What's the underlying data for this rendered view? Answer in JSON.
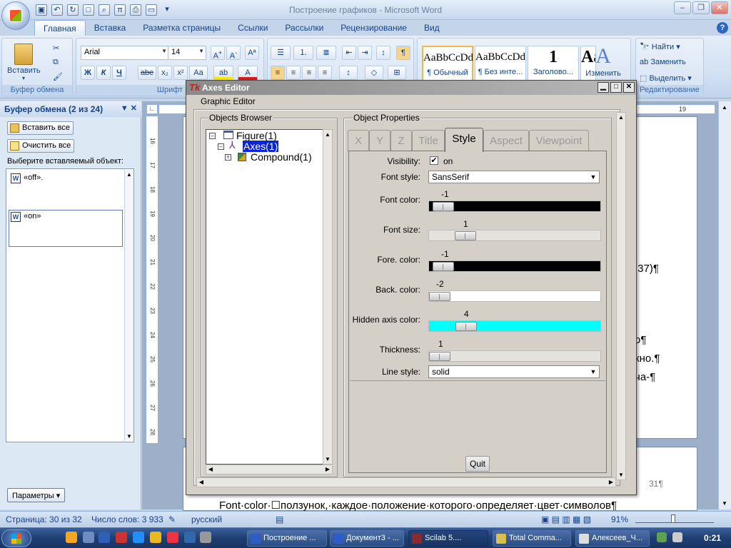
{
  "app": {
    "title": "Построение графиков - Microsoft Word",
    "help": "?"
  },
  "tabs": [
    "Главная",
    "Вставка",
    "Разметка страницы",
    "Ссылки",
    "Рассылки",
    "Рецензирование",
    "Вид"
  ],
  "ribbon": {
    "paste_label": "Вставить",
    "clipboard_group": "Буфер обмена",
    "font_group": "Шрифт",
    "edit_group": "Редактирование",
    "font_name": "Arial",
    "font_size": "14",
    "bold": "Ж",
    "italic": "К",
    "underline": "Ч",
    "strike": "abe",
    "styles": [
      {
        "preview": "AaBbCcDd",
        "caption": "¶ Обычный"
      },
      {
        "preview": "AaBbCcDd",
        "caption": "¶ Без инте..."
      },
      {
        "preview": "1",
        "caption": "Заголово..."
      },
      {
        "preview": "Aa",
        "caption": ""
      }
    ],
    "change_styles": "Изменить",
    "find": "Найти",
    "replace": "Заменить",
    "select": "Выделить"
  },
  "clipboard_pane": {
    "title": "Буфер обмена (2 из 24)",
    "paste_all": "Вставить все",
    "clear_all": "Очистить все",
    "choose_label": "Выберите вставляемый объект:",
    "items": [
      "«off».",
      "«on»"
    ],
    "options": "Параметры"
  },
  "document": {
    "ruler_numbers": [
      "16",
      "17",
      "18",
      "19",
      "20",
      "21",
      "22",
      "23",
      "24",
      "25",
      "26",
      "27",
      "28"
    ],
    "hruler_mark": "19",
    "fragments": [
      ".37)¶",
      "о¶",
      "кно.¶",
      "ча-¶"
    ],
    "page_number": "31¶",
    "bottom_line": "Font·color·☐ползунок,·каждое·положение·которого·определяет·цвет·символов¶"
  },
  "status": {
    "page": "Страница: 30 из 32",
    "words": "Число слов: 3 933",
    "language": "русский",
    "zoom": "91%"
  },
  "taskbar": {
    "items": [
      "Построение ...",
      "Документ3 - ...",
      "Scilab 5....",
      "Total Comma...",
      "Алексеев_Ч..."
    ],
    "clock": "0:21"
  },
  "dialog": {
    "title": "Axes Editor",
    "menu": "Graphic Editor",
    "objects_browser": "Objects Browser",
    "object_properties": "Object Properties",
    "tree": [
      {
        "label": "Figure(1)",
        "selected": false
      },
      {
        "label": "Axes(1)",
        "selected": true
      },
      {
        "label": "Compound(1)",
        "selected": false
      }
    ],
    "tabs": [
      "X",
      "Y",
      "Z",
      "Title",
      "Style",
      "Aspect",
      "Viewpoint"
    ],
    "active_tab": "Style",
    "properties": {
      "visibility_label": "Visibility:",
      "visibility_value": "on",
      "font_style_label": "Font style:",
      "font_style_value": "SansSerif",
      "font_color_label": "Font color:",
      "font_color_value": "-1",
      "font_size_label": "Font size:",
      "font_size_value": "1",
      "fore_color_label": "Fore. color:",
      "fore_color_value": "-1",
      "back_color_label": "Back. color:",
      "back_color_value": "-2",
      "hidden_axis_label": "Hidden axis color:",
      "hidden_axis_value": "4",
      "thickness_label": "Thickness:",
      "thickness_value": "1",
      "line_style_label": "Line style:",
      "line_style_value": "solid"
    },
    "quit": "Quit",
    "colors": {
      "black": "#000000",
      "white": "#ffffff",
      "cyan": "#00ffff"
    }
  }
}
